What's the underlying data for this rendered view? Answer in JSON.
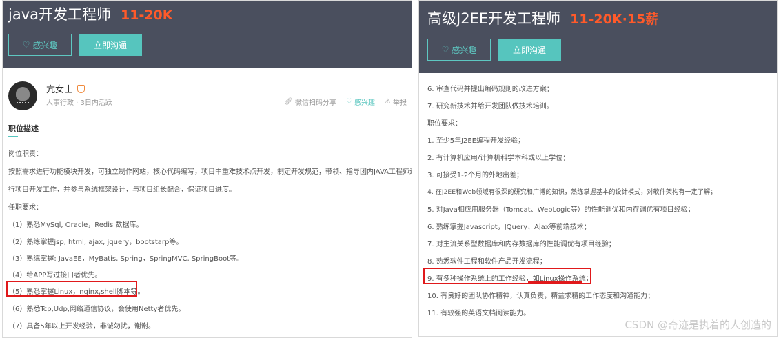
{
  "left": {
    "title": "java开发工程师",
    "salary": "11-20K",
    "interest_label": "感兴趣",
    "chat_label": "立即沟通",
    "poster_name": "亢女士",
    "poster_meta": "人事行政 · 3日内活跃",
    "share_label": "微信扫码分享",
    "fav_label": "感兴趣",
    "report_label": "举报",
    "section_title": "职位描述",
    "lines": [
      "岗位职责：",
      "按照需求进行功能模块开发，可独立制作网站，核心代码编写，项目中重难技术点开发，制定开发规范，带领、指导团内JAVA工程师进",
      "行项目开发工作，并参与系统框架设计，与项目组长配合，保证项目进度。",
      "任职要求：",
      "（1）熟悉MySql, Oracle，Redis 数据库。",
      "（2）熟练掌握jsp, html, ajax, jquery，bootstarp等。",
      "（3）熟练掌握: JavaEE，MyBatis, Spring，SpringMVC, SpringBoot等。",
      "（4）给APP写过接口者优先。",
      "（5）熟悉掌握Linux，nginx,shell脚本等。",
      "（6）熟悉Tcp,Udp,网络通信协议，会使用Netty者优先。",
      "（7）具备5年以上开发经验，非诚勿扰，谢谢。"
    ]
  },
  "right": {
    "title": "高级J2EE开发工程师",
    "salary": "11-20K·15薪",
    "interest_label": "感兴趣",
    "chat_label": "立即沟通",
    "lines": [
      "6. 审查代码并提出编码规则的改进方案；",
      "7. 研究新技术并给开发团队做技术培训。",
      "职位要求：",
      "1. 至少5年J2EE编程开发经验；",
      "2. 有计算机应用/计算机科学本科或以上学位；",
      "3. 可接受1-2个月的外地出差；",
      "4. 在J2EE和Web领域有很深的研究和广博的知识，熟练掌握基本的设计模式，对软件架构有一定了解；",
      "5. 对Java相应用服务器（Tomcat、WebLogic等）的性能调优和内存调优有项目经验；",
      "6. 熟练掌握Javascript，JQuery、Ajax等前端技术；",
      "7. 对主流关系型数据库和内存数据库的性能调优有项目经验；",
      "8. 熟悉软件工程和软件产品开发流程；",
      "9. 有多种操作系统上的工作经验，如Linux操作系统；",
      "10. 有良好的团队协作精神，认真负责，精益求精的工作态度和沟通能力；",
      "11. 有较强的英语文档阅读能力。"
    ]
  },
  "watermark": "CSDN @奇迹是执着的人创造的",
  "colors": {
    "banner": "#4a4f5e",
    "salary": "#ff5a2a",
    "accent": "#56c5be",
    "highlight": "#e0191b"
  }
}
